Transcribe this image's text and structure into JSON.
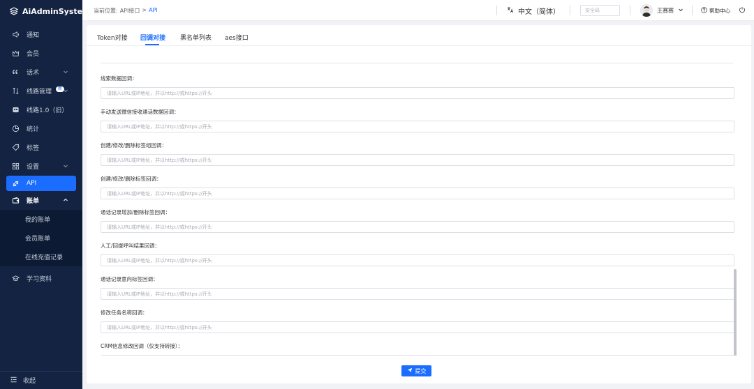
{
  "app": {
    "name": "AiAdminSystem"
  },
  "sidebar": {
    "items": [
      {
        "label": "通知",
        "icon": "megaphone-icon"
      },
      {
        "label": "会员",
        "icon": "crown-icon"
      },
      {
        "label": "话术",
        "icon": "quote-icon",
        "has_children": true
      },
      {
        "label": "线路管理",
        "icon": "route-icon",
        "has_children": true,
        "badge": "新"
      },
      {
        "label": "线路1.0（旧）",
        "icon": "cube-icon"
      },
      {
        "label": "统计",
        "icon": "pie-icon"
      },
      {
        "label": "标签",
        "icon": "tag-icon"
      },
      {
        "label": "设置",
        "icon": "grid-icon",
        "has_children": true
      },
      {
        "label": "API",
        "icon": "api-icon",
        "active": true
      },
      {
        "label": "账单",
        "icon": "wallet-icon",
        "open": true
      }
    ],
    "bill_submenu": [
      "我的账单",
      "会员账单",
      "在线充值记录"
    ],
    "learning": {
      "label": "学习资料",
      "icon": "graduation-icon"
    },
    "collapse_label": "收起"
  },
  "header": {
    "breadcrumb_prefix": "当前位置:",
    "breadcrumb_parent": "API接口",
    "breadcrumb_sep": ">",
    "breadcrumb_current": "API",
    "language": "中文（简体）",
    "security_placeholder": "安全码",
    "user_name": "王赛赛",
    "help_label": "帮助中心"
  },
  "tabs": [
    {
      "label": "Token对接"
    },
    {
      "label": "回调对接",
      "active": true
    },
    {
      "label": "黑名单列表"
    },
    {
      "label": "aes接口"
    }
  ],
  "form": {
    "placeholder_a": "请输入URL或IP地址，并以http://或https://开头",
    "fields": [
      {
        "label": "线索数据回调：",
        "placeholder": "请输入URL或IP地址，并以http://或https://开头"
      },
      {
        "label": "手动发送微信接收通话数据回调：",
        "placeholder": "请输入URL或IP地址，并以http://或https://开头"
      },
      {
        "label": "创建/修改/删除标签组回调：",
        "placeholder": "请输入URL或IP地址，并以http://或https://开头"
      },
      {
        "label": "创建/修改/删除标签回调：",
        "placeholder": "请输入URL或IP地址，并以http://或https://开头"
      },
      {
        "label": "通话记录增加/删除标签回调：",
        "placeholder": "请输入URL或IP地址，并以http://或https://开头"
      },
      {
        "label": "人工/回拨呼叫结果回调：",
        "placeholder": "请输入URL或IP地址，并以http://或https://开头"
      },
      {
        "label": "通话记录意向标签回调：",
        "placeholder": "请输入URL或IP地址，并以http://或https://开头"
      },
      {
        "label": "修改任务名称回调：",
        "placeholder": "请输入URL或IP地址，并以http://或https://开头"
      },
      {
        "label": "CRM信息修改回调（仅支持转接）：",
        "placeholder": ""
      }
    ],
    "submit_label": "提交"
  },
  "colors": {
    "primary": "#1a6dff",
    "sidebar_bg": "#132341"
  }
}
